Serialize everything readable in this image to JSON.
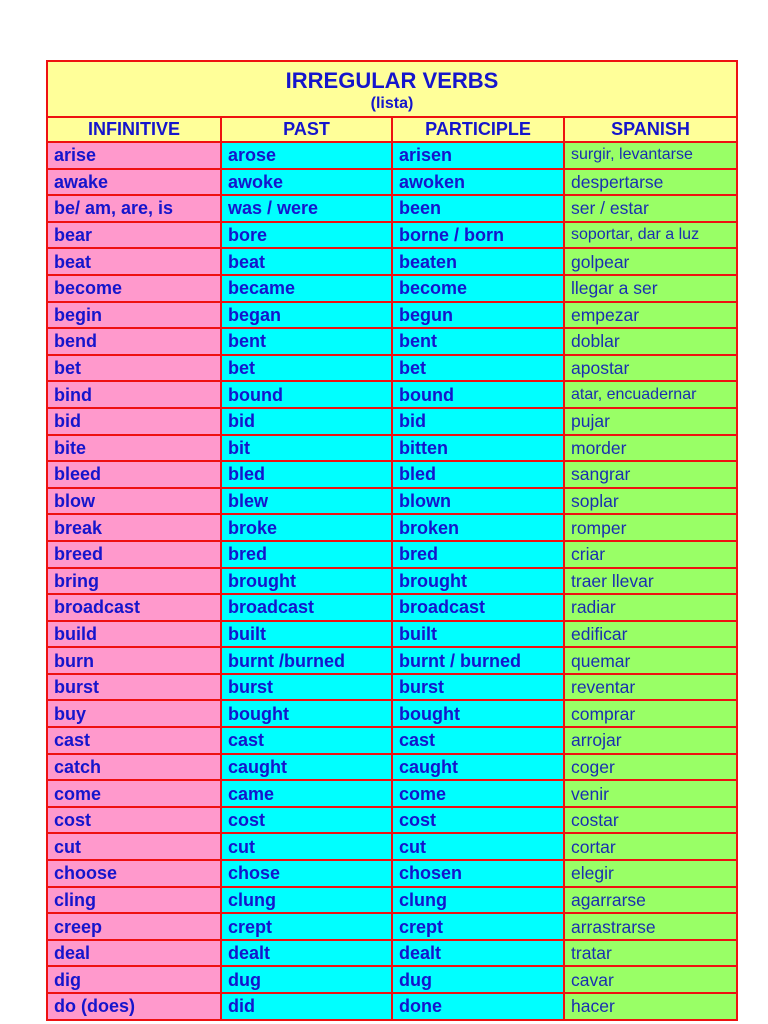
{
  "title": "IRREGULAR VERBS",
  "subtitle": "(lista)",
  "columns": [
    "INFINITIVE",
    "PAST",
    "PARTICIPLE",
    "SPANISH"
  ],
  "colors": {
    "border": "#ee1111",
    "header_bg": "#ffff99",
    "infinitive_bg": "#ff99cc",
    "past_bg": "#00ffff",
    "participle_bg": "#00ffff",
    "spanish_bg": "#99ff66",
    "text": "#1515cc"
  },
  "rows": [
    [
      "arise",
      "arose",
      "arisen",
      "surgir, levantarse"
    ],
    [
      "awake",
      "awoke",
      "awoken",
      "despertarse"
    ],
    [
      "be/ am, are, is",
      "was / were",
      "been",
      "ser / estar"
    ],
    [
      "bear",
      "bore",
      "borne / born",
      "soportar, dar a luz"
    ],
    [
      "beat",
      "beat",
      "beaten",
      "golpear"
    ],
    [
      "become",
      "became",
      "become",
      "llegar a ser"
    ],
    [
      "begin",
      "began",
      "begun",
      "empezar"
    ],
    [
      "bend",
      "bent",
      "bent",
      "doblar"
    ],
    [
      "bet",
      "bet",
      "bet",
      "apostar"
    ],
    [
      "bind",
      "bound",
      "bound",
      "atar, encuadernar"
    ],
    [
      "bid",
      "bid",
      "bid",
      "pujar"
    ],
    [
      "bite",
      "bit",
      "bitten",
      "morder"
    ],
    [
      "bleed",
      "bled",
      "bled",
      "sangrar"
    ],
    [
      "blow",
      "blew",
      "blown",
      "soplar"
    ],
    [
      "break",
      "broke",
      "broken",
      "romper"
    ],
    [
      "breed",
      "bred",
      "bred",
      "criar"
    ],
    [
      "bring",
      "brought",
      "brought",
      "traer llevar"
    ],
    [
      "broadcast",
      "broadcast",
      "broadcast",
      "radiar"
    ],
    [
      "build",
      "built",
      "built",
      "edificar"
    ],
    [
      "burn",
      "burnt /burned",
      "burnt / burned",
      "quemar"
    ],
    [
      "burst",
      "burst",
      "burst",
      "reventar"
    ],
    [
      "buy",
      "bought",
      "bought",
      "comprar"
    ],
    [
      "cast",
      "cast",
      "cast",
      "arrojar"
    ],
    [
      "catch",
      "caught",
      "caught",
      "coger"
    ],
    [
      "come",
      "came",
      "come",
      "venir"
    ],
    [
      "cost",
      "cost",
      "cost",
      "costar"
    ],
    [
      "cut",
      "cut",
      "cut",
      "cortar"
    ],
    [
      "choose",
      "chose",
      "chosen",
      "elegir"
    ],
    [
      "cling",
      "clung",
      "clung",
      "agarrarse"
    ],
    [
      "creep",
      "crept",
      "crept",
      "arrastrarse"
    ],
    [
      "deal",
      "dealt",
      "dealt",
      "tratar"
    ],
    [
      "dig",
      "dug",
      "dug",
      "cavar"
    ],
    [
      "do (does)",
      "did",
      "done",
      "hacer"
    ]
  ]
}
